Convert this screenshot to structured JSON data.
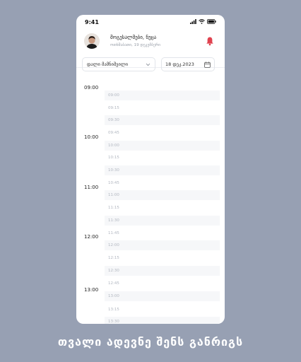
{
  "status_bar": {
    "time": "9:41"
  },
  "header": {
    "greeting": "მოგესალმები, ნუცა",
    "date": "ოთხშაბათი, 19 დეკემბერი"
  },
  "filters": {
    "doctor": "დალი მამნიშვილი",
    "date": "18 დეკ.2023"
  },
  "schedule": {
    "hours": [
      "09:00",
      "10:00",
      "11:00",
      "12:00",
      "13:00"
    ],
    "slots": [
      "09:00",
      "09:15",
      "09:30",
      "09:45",
      "10:00",
      "10:15",
      "10:30",
      "10:45",
      "11:00",
      "11:15",
      "11:30",
      "11:45",
      "12:00",
      "12:15",
      "12:30",
      "12:45",
      "13:00",
      "13:15",
      "13:30"
    ]
  },
  "caption": "თვალი ადევნე შენს განრიგს",
  "colors": {
    "background": "#97a0b3",
    "bell": "#e0424f",
    "slot_shade": "#f6f7f9"
  }
}
